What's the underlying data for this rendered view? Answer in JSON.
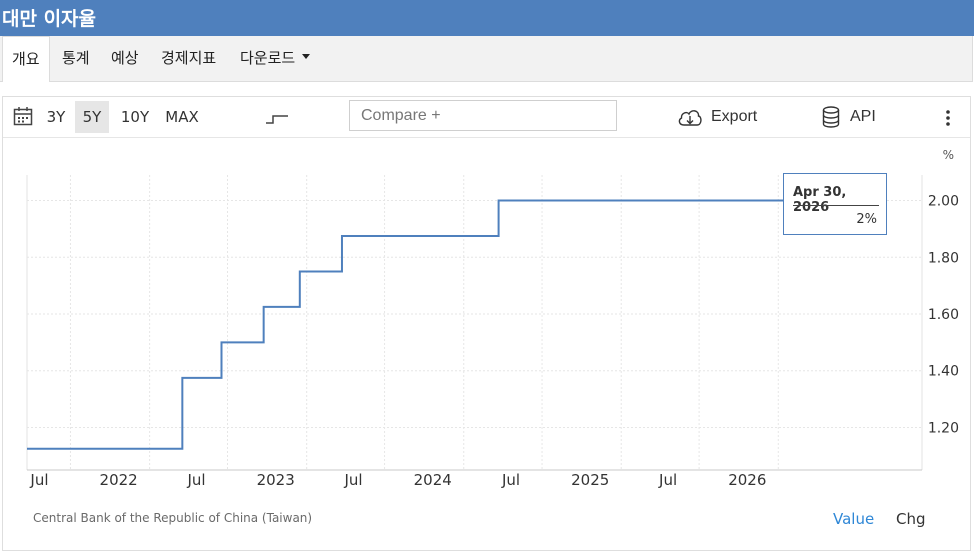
{
  "page": {
    "title": "대만 이자율"
  },
  "tabs": [
    {
      "label": "개요",
      "active": true
    },
    {
      "label": "통계"
    },
    {
      "label": "예상"
    },
    {
      "label": "경제지표"
    },
    {
      "label": "다운로드"
    }
  ],
  "toolbar": {
    "ranges": [
      "3Y",
      "5Y",
      "10Y",
      "MAX"
    ],
    "active_range": "5Y",
    "compare_placeholder": "Compare +",
    "export_label": "Export",
    "api_label": "API"
  },
  "tooltip": {
    "date": "Apr 30, 2026",
    "value": "2%"
  },
  "source": "Central Bank of the Republic of China (Taiwan)",
  "value_toggle": {
    "value": "Value",
    "chg": "Chg"
  },
  "colors": {
    "header": "#4f80bd",
    "line": "#4f80bd",
    "link": "#2f87d6"
  },
  "chart_data": {
    "type": "line",
    "step": true,
    "y_unit": "%",
    "ylim": [
      1.05,
      2.09
    ],
    "yticks": [
      "1.20",
      "1.40",
      "1.60",
      "1.80",
      "2.00"
    ],
    "xlim": [
      "2021-03-22",
      "2026-12-01"
    ],
    "xticks": [
      {
        "label": "Jul",
        "x": "2021-07-01"
      },
      {
        "label": "2022",
        "x": "2022-01-01"
      },
      {
        "label": "Jul",
        "x": "2022-07-01"
      },
      {
        "label": "2023",
        "x": "2023-01-01"
      },
      {
        "label": "Jul",
        "x": "2023-07-01"
      },
      {
        "label": "2024",
        "x": "2024-01-01"
      },
      {
        "label": "Jul",
        "x": "2024-07-01"
      },
      {
        "label": "2025",
        "x": "2025-01-01"
      },
      {
        "label": "Jul",
        "x": "2025-07-01"
      },
      {
        "label": "2026",
        "x": "2026-01-01"
      }
    ],
    "grid": true,
    "series": [
      {
        "points": [
          {
            "x": "2021-03-22",
            "y": 1.125
          },
          {
            "x": "2022-03-18",
            "y": 1.375
          },
          {
            "x": "2022-06-17",
            "y": 1.5
          },
          {
            "x": "2022-09-23",
            "y": 1.625
          },
          {
            "x": "2022-12-16",
            "y": 1.75
          },
          {
            "x": "2023-03-24",
            "y": 1.875
          },
          {
            "x": "2024-03-22",
            "y": 2.0
          },
          {
            "x": "2026-04-30",
            "y": 2.0
          }
        ]
      }
    ]
  }
}
